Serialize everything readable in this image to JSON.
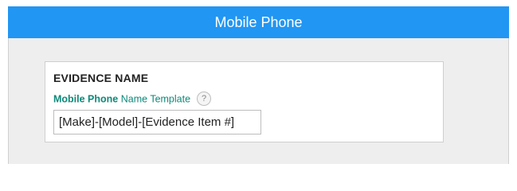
{
  "dialog": {
    "title": "Mobile Phone"
  },
  "evidence_name_section": {
    "heading": "EVIDENCE NAME",
    "field_label_strong": "Mobile Phone",
    "field_label_rest": " Name Template",
    "help_icon_glyph": "?",
    "template_value": "[Make]-[Model]-[Evidence Item #]"
  },
  "colors": {
    "header_bg": "#2196f3",
    "label_teal": "#0d8a7a",
    "panel_bg": "#eeeeee"
  }
}
